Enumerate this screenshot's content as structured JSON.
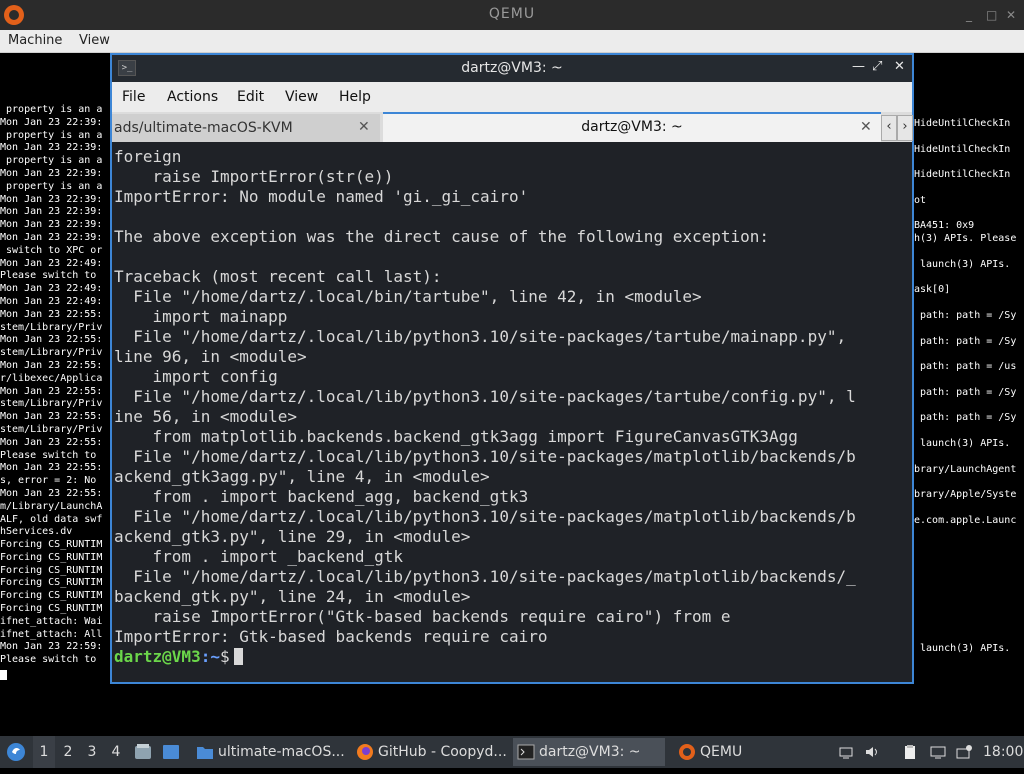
{
  "qemu": {
    "title": "QEMU",
    "menu": [
      "Machine",
      "View"
    ],
    "controls": {
      "minimize": "_",
      "maximize": "□",
      "close": "✕"
    }
  },
  "console_left": [
    " property is an a",
    "Mon Jan 23 22:39:",
    " property is an a",
    "Mon Jan 23 22:39:",
    " property is an a",
    "Mon Jan 23 22:39:",
    " property is an a",
    "Mon Jan 23 22:39:",
    "Mon Jan 23 22:39:",
    "Mon Jan 23 22:39:",
    "Mon Jan 23 22:39:",
    " switch to XPC or",
    "Mon Jan 23 22:49:",
    "Please switch to ",
    "Mon Jan 23 22:49:",
    "Mon Jan 23 22:49:",
    "Mon Jan 23 22:55:",
    "stem/Library/Priv",
    "Mon Jan 23 22:55:",
    "stem/Library/Priv",
    "Mon Jan 23 22:55:",
    "r/libexec/Applica",
    "Mon Jan 23 22:55:",
    "stem/Library/Priv",
    "Mon Jan 23 22:55:",
    "stem/Library/Priv",
    "Mon Jan 23 22:55:",
    "Please switch to ",
    "Mon Jan 23 22:55:",
    "s, error = 2: No ",
    "Mon Jan 23 22:55:",
    "m/Library/LaunchA",
    "ALF, old data swf",
    "hServices.dv",
    "Forcing CS_RUNTIM",
    "Forcing CS_RUNTIM",
    "Forcing CS_RUNTIM",
    "Forcing CS_RUNTIM",
    "Forcing CS_RUNTIM",
    "Forcing CS_RUNTIM",
    "ifnet_attach: Wai",
    "ifnet_attach: All",
    "Mon Jan 23 22:59:",
    "Please switch to "
  ],
  "console_right": [
    {
      "row": 0,
      "text": "HideUntilCheckIn"
    },
    {
      "row": 2,
      "text": "HideUntilCheckIn"
    },
    {
      "row": 4,
      "text": "HideUntilCheckIn"
    },
    {
      "row": 6,
      "text": "ot"
    },
    {
      "row": 8,
      "text": "BA451: 0x9"
    },
    {
      "row": 9,
      "text": "h(3) APIs. Please"
    },
    {
      "row": 11,
      "text": " launch(3) APIs."
    },
    {
      "row": 13,
      "text": "ask[0]"
    },
    {
      "row": 15,
      "text": " path: path = /Sy"
    },
    {
      "row": 17,
      "text": " path: path = /Sy"
    },
    {
      "row": 19,
      "text": " path: path = /us"
    },
    {
      "row": 21,
      "text": " path: path = /Sy"
    },
    {
      "row": 23,
      "text": " path: path = /Sy"
    },
    {
      "row": 25,
      "text": " launch(3) APIs."
    },
    {
      "row": 27,
      "text": "brary/LaunchAgent"
    },
    {
      "row": 29,
      "text": "brary/Apple/Syste"
    },
    {
      "row": 31,
      "text": "e.com.apple.Launc"
    },
    {
      "row": 41,
      "text": " launch(3) APIs."
    }
  ],
  "terminal": {
    "title": "dartz@VM3: ~",
    "menu": [
      "File",
      "Actions",
      "Edit",
      "View",
      "Help"
    ],
    "tabs": [
      {
        "label": "ads/ultimate-macOS-KVM",
        "active": false
      },
      {
        "label": "dartz@VM3: ~",
        "active": true
      }
    ],
    "lines": [
      "foreign",
      "    raise ImportError(str(e))",
      "ImportError: No module named 'gi._gi_cairo'",
      "",
      "The above exception was the direct cause of the following exception:",
      "",
      "Traceback (most recent call last):",
      "  File \"/home/dartz/.local/bin/tartube\", line 42, in <module>",
      "    import mainapp",
      "  File \"/home/dartz/.local/lib/python3.10/site-packages/tartube/mainapp.py\",",
      "line 96, in <module>",
      "    import config",
      "  File \"/home/dartz/.local/lib/python3.10/site-packages/tartube/config.py\", l",
      "ine 56, in <module>",
      "    from matplotlib.backends.backend_gtk3agg import FigureCanvasGTK3Agg",
      "  File \"/home/dartz/.local/lib/python3.10/site-packages/matplotlib/backends/b",
      "ackend_gtk3agg.py\", line 4, in <module>",
      "    from . import backend_agg, backend_gtk3",
      "  File \"/home/dartz/.local/lib/python3.10/site-packages/matplotlib/backends/b",
      "ackend_gtk3.py\", line 29, in <module>",
      "    from . import _backend_gtk",
      "  File \"/home/dartz/.local/lib/python3.10/site-packages/matplotlib/backends/_",
      "backend_gtk.py\", line 24, in <module>",
      "    raise ImportError(\"Gtk-based backends require cairo\") from e",
      "ImportError: Gtk-based backends require cairo"
    ],
    "prompt": {
      "user": "dartz@VM3",
      "path": ":~",
      "symbol": "$"
    }
  },
  "taskbar": {
    "workspaces": [
      "1",
      "2",
      "3",
      "4"
    ],
    "active_workspace": "1",
    "windows": [
      {
        "label": "ultimate-macOS...",
        "icon": "folder-icon"
      },
      {
        "label": "GitHub - Coopyd...",
        "icon": "firefox-icon"
      },
      {
        "label": "dartz@VM3: ~",
        "icon": "terminal-icon"
      },
      {
        "label": "QEMU",
        "icon": "qemu-icon"
      }
    ],
    "clock": "18:00"
  },
  "colors": {
    "terminal_bg": "#1f2227",
    "accent": "#3d86d6",
    "prompt_user": "#6bd64a",
    "prompt_path": "#6aa0ff"
  }
}
